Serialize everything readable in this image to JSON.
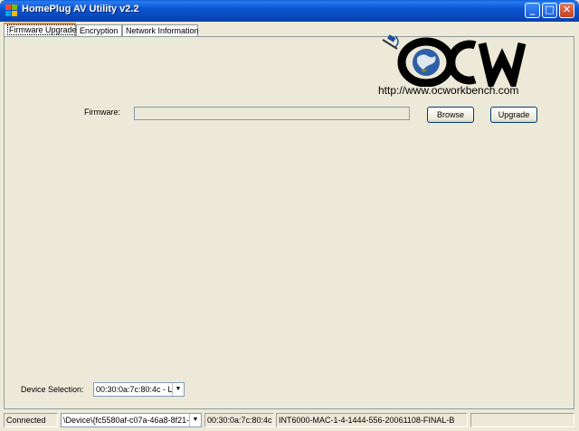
{
  "window": {
    "title": "HomePlug AV Utility v2.2",
    "controls": {
      "minimize": "_",
      "maximize": "□",
      "close": "✕"
    }
  },
  "tabs": [
    {
      "label": "Firmware Upgrade",
      "active": true
    },
    {
      "label": "Encryption",
      "active": false
    },
    {
      "label": "Network Information",
      "active": false
    }
  ],
  "logo": {
    "text": "OCW",
    "url": "http://www.ocworkbench.com"
  },
  "firmware": {
    "label": "Firmware:",
    "value": "",
    "browse_label": "Browse",
    "upgrade_label": "Upgrade"
  },
  "device_selection": {
    "label": "Device Selection:",
    "selected": "00:30:0a:7c:80:4c - L"
  },
  "statusbar": {
    "status": "Connected",
    "device_path": "\\Device\\{fc5580af-c07a-46a8-8f21-(",
    "mac": "00:30:0a:7c:80:4c",
    "firmware_version": "INT6000-MAC-1-4-1444-556-20061108-FINAL-B",
    "extra": ""
  },
  "colors": {
    "titlebar": "#0a55d0",
    "active_tab_highlight": "#e68b2c",
    "window_bg": "#ece9d8",
    "logo_ring": "#000000"
  }
}
